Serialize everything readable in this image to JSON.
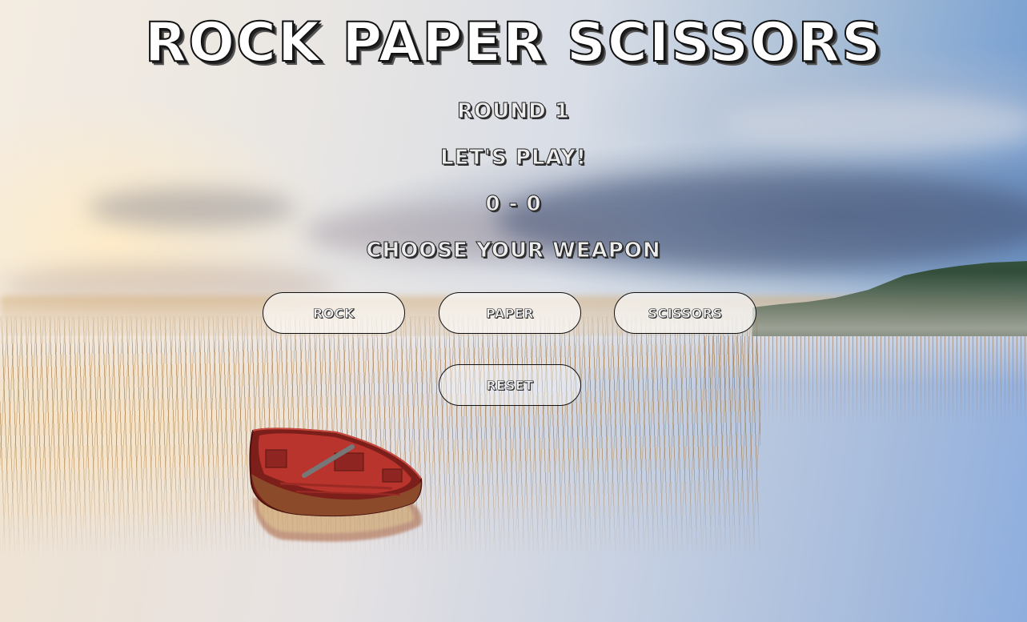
{
  "game": {
    "title": "ROCK PAPER SCISSORS",
    "round_label": "ROUND 1",
    "message": "LET'S PLAY!",
    "score": "0 - 0",
    "prompt": "CHOOSE YOUR WEAPON"
  },
  "buttons": {
    "rock": "ROCK",
    "paper": "PAPER",
    "scissors": "SCISSORS",
    "reset": "RESET"
  },
  "theme": {
    "text_fill": "#ffffff",
    "text_outline": "#111111",
    "button_fill": "rgba(255,255,255,0.62)",
    "boat_hull": "#8e2a24"
  }
}
